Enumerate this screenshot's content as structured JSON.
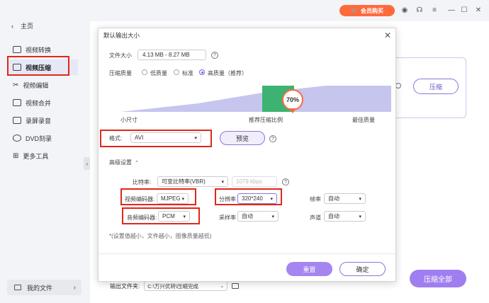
{
  "titlebar": {
    "vip_label": "会员购买"
  },
  "sidebar": {
    "back_label": "主页",
    "items": [
      {
        "label": "视频转换",
        "icon": "video-convert-icon"
      },
      {
        "label": "视频压缩",
        "icon": "video-compress-icon"
      },
      {
        "label": "视频编辑",
        "icon": "scissors-icon"
      },
      {
        "label": "视频合并",
        "icon": "merge-icon"
      },
      {
        "label": "录屏录音",
        "icon": "record-icon"
      },
      {
        "label": "DVD刻录",
        "icon": "disc-icon"
      },
      {
        "label": "更多工具",
        "icon": "grid-icon"
      }
    ],
    "active_index": 1,
    "my_files": "我的文件"
  },
  "main": {
    "compress_button": "压缩",
    "compress_all_button": "压缩全部",
    "output_label": "输出文件夹:",
    "output_path": "C:\\万兴优转\\压缩完成"
  },
  "dialog": {
    "title": "默认输出大小",
    "file_size_label": "文件大小",
    "file_size_value": "4.13 MB - 8.27 MB",
    "quality_label": "压缩质量",
    "quality_options": [
      "低质量",
      "标准",
      "高质量（推荐）"
    ],
    "quality_selected": 2,
    "slider": {
      "percent_label": "70%",
      "percent": 70,
      "left_label": "小尺寸",
      "middle_label": "推荐压缩比例",
      "right_label": "最佳质量"
    },
    "format_label": "格式:",
    "format_value": "AVI",
    "preview_button": "预览",
    "advanced_label": "高级设置",
    "bitrate_label": "比特率:",
    "bitrate_value": "可变比特率(VBR)",
    "bitrate_kbps": "1079 kbps",
    "video_encoder_label": "视频编码器:",
    "video_encoder_value": "MJPEG",
    "resolution_label": "分辨率",
    "resolution_value": "320*240",
    "framerate_label": "帧率",
    "framerate_value": "自动",
    "audio_encoder_label": "音频编码器:",
    "audio_encoder_value": "PCM",
    "samplerate_label": "采样率",
    "samplerate_value": "自动",
    "channel_label": "声道",
    "channel_value": "自动",
    "footnote": "*(设置值越小，文件越小，图像质量越低)",
    "reset_button": "重置",
    "ok_button": "确定"
  },
  "colors": {
    "accent": "#8a74e0",
    "vip": "#ff6a3d",
    "highlight_box": "#e0271a",
    "recommended_band": "#3cb371",
    "slope": "#c5c5ee"
  }
}
